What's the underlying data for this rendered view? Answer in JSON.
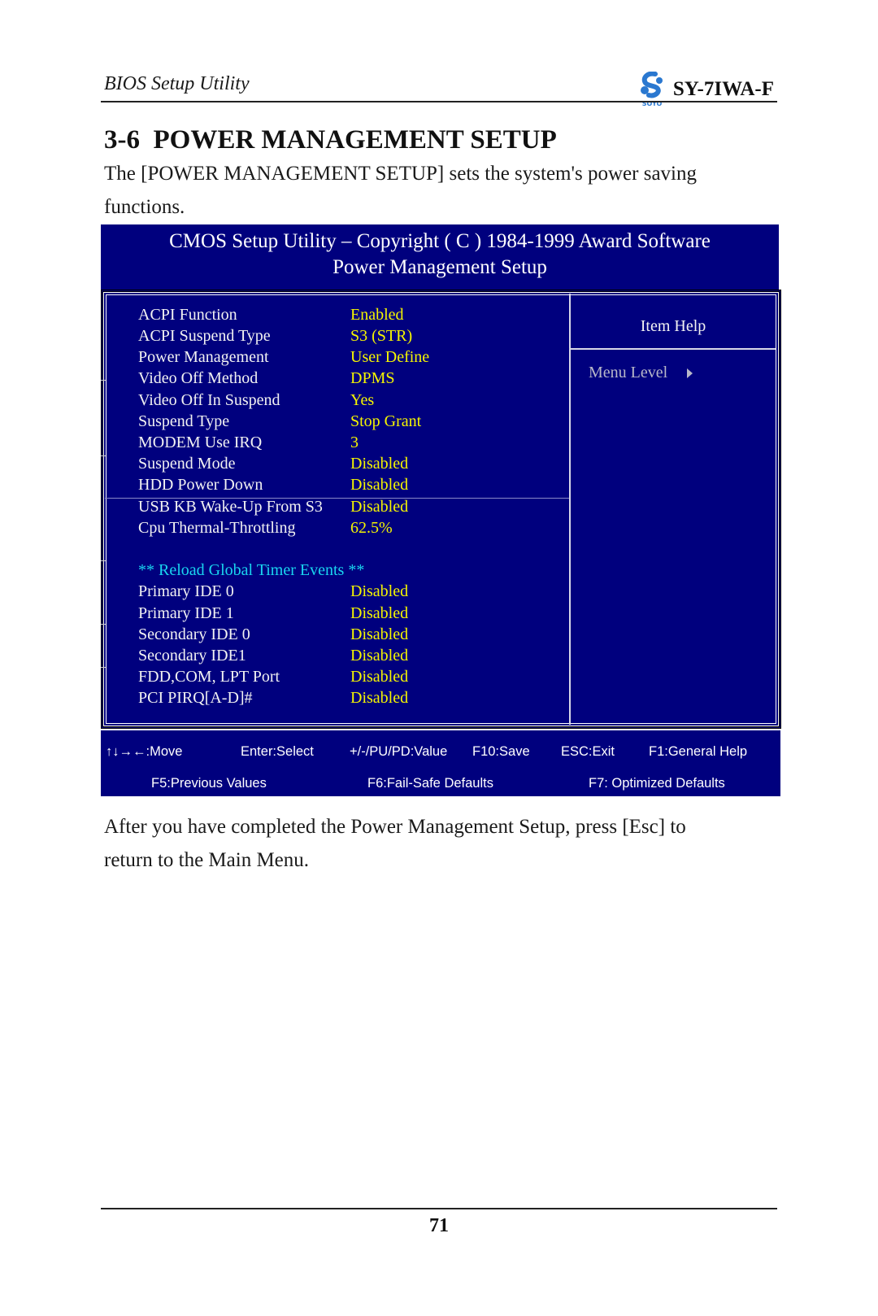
{
  "page_header": {
    "left_title": "BIOS Setup Utility",
    "brand_logo": "soyo-logo",
    "brand_text": "SOYO",
    "model": "SY-7IWA-F"
  },
  "section": {
    "title": "3-6  POWER MANAGEMENT SETUP",
    "intro_line1": "The [POWER MANAGEMENT SETUP] sets the system's power saving",
    "intro_line2": "functions."
  },
  "bios": {
    "header_line1": "CMOS Setup Utility – Copyright ( C ) 1984-1999 Award Software",
    "header_line2": "Power Management Setup",
    "colors": {
      "background": "#00007e",
      "label": "#f2f2f2",
      "value": "#f5f500",
      "section": "#19d6f0"
    },
    "items": [
      {
        "label": "ACPI Function",
        "value": "Enabled"
      },
      {
        "label": "ACPI Suspend Type",
        "value": "S3 (STR)"
      },
      {
        "label": "Power Management",
        "value": "User Define"
      },
      {
        "label": "Video Off Method",
        "value": "DPMS"
      },
      {
        "label": "Video Off In Suspend",
        "value": "Yes"
      },
      {
        "label": "Suspend Type",
        "value": "Stop Grant"
      },
      {
        "label": "MODEM Use IRQ",
        "value": "3"
      },
      {
        "label": "Suspend Mode",
        "value": "Disabled"
      },
      {
        "label": "HDD Power Down",
        "value": "Disabled"
      },
      {
        "label": "USB KB Wake-Up From S3",
        "value": "Disabled"
      },
      {
        "label": "Cpu Thermal-Throttling",
        "value": "62.5%"
      }
    ],
    "section_heading": "** Reload Global Timer Events **",
    "timer_items": [
      {
        "label": "Primary IDE 0",
        "value": "Disabled"
      },
      {
        "label": "Primary IDE 1",
        "value": "Disabled"
      },
      {
        "label": "Secondary IDE 0",
        "value": "Disabled"
      },
      {
        "label": "Secondary IDE1",
        "value": "Disabled"
      },
      {
        "label": "FDD,COM, LPT Port",
        "value": "Disabled"
      },
      {
        "label": "PCI PIRQ[A-D]#",
        "value": "Disabled"
      }
    ],
    "help": {
      "title": "Item Help",
      "menu_level": "Menu Level",
      "menu_level_icon": "triangle-right-icon"
    },
    "footer_row1": [
      {
        "key": "↑↓→←:Move"
      },
      {
        "key": "Enter:Select"
      },
      {
        "key": "+/-/PU/PD:Value"
      },
      {
        "key": "F10:Save"
      },
      {
        "key": "ESC:Exit"
      },
      {
        "key": "F1:General Help"
      }
    ],
    "footer_row2": [
      {
        "key": "F5:Previous Values"
      },
      {
        "key": "F6:Fail-Safe Defaults"
      },
      {
        "key": "F7: Optimized Defaults"
      }
    ]
  },
  "closing": {
    "line1": "After you have completed the Power Management Setup, press [Esc] to",
    "line2": "return to the Main Menu."
  },
  "page_footer": {
    "page_number": "71"
  }
}
